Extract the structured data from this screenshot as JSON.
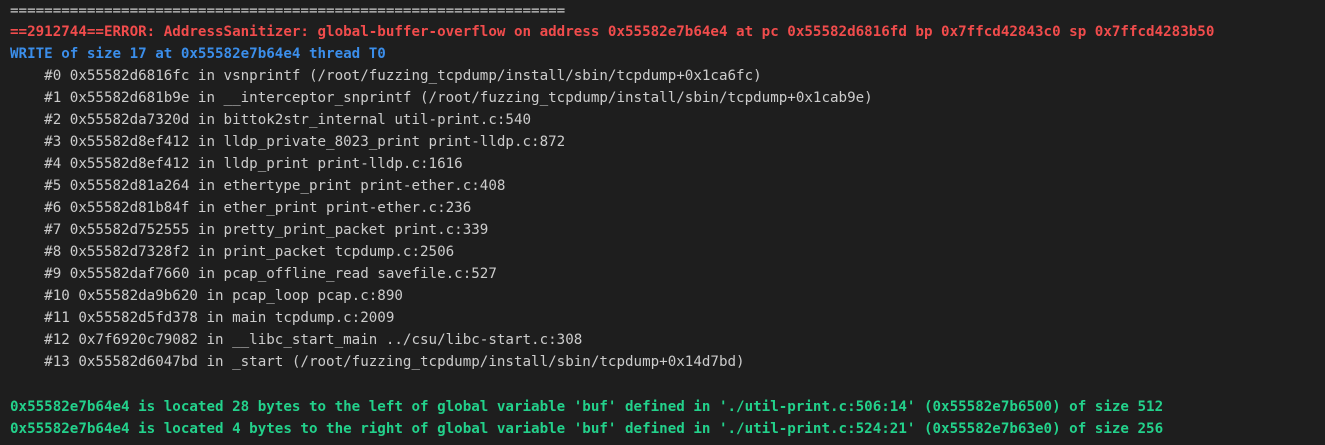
{
  "terminal": {
    "separator": "=================================================================",
    "error_header": "==2912744==ERROR: AddressSanitizer: global-buffer-overflow on address 0x55582e7b64e4 at pc 0x55582d6816fd bp 0x7ffcd42843c0 sp 0x7ffcd4283b50",
    "write_line": "WRITE of size 17 at 0x55582e7b64e4 thread T0",
    "frames": [
      "    #0 0x55582d6816fc in vsnprintf (/root/fuzzing_tcpdump/install/sbin/tcpdump+0x1ca6fc)",
      "    #1 0x55582d681b9e in __interceptor_snprintf (/root/fuzzing_tcpdump/install/sbin/tcpdump+0x1cab9e)",
      "    #2 0x55582da7320d in bittok2str_internal util-print.c:540",
      "    #3 0x55582d8ef412 in lldp_private_8023_print print-lldp.c:872",
      "    #4 0x55582d8ef412 in lldp_print print-lldp.c:1616",
      "    #5 0x55582d81a264 in ethertype_print print-ether.c:408",
      "    #6 0x55582d81b84f in ether_print print-ether.c:236",
      "    #7 0x55582d752555 in pretty_print_packet print.c:339",
      "    #8 0x55582d7328f2 in print_packet tcpdump.c:2506",
      "    #9 0x55582daf7660 in pcap_offline_read savefile.c:527",
      "    #10 0x55582da9b620 in pcap_loop pcap.c:890",
      "    #11 0x55582d5fd378 in main tcpdump.c:2009",
      "    #12 0x7f6920c79082 in __libc_start_main ../csu/libc-start.c:308",
      "    #13 0x55582d6047bd in _start (/root/fuzzing_tcpdump/install/sbin/tcpdump+0x14d7bd)"
    ],
    "location_left": "0x55582e7b64e4 is located 28 bytes to the left of global variable 'buf' defined in './util-print.c:506:14' (0x55582e7b6500) of size 512",
    "location_right": "0x55582e7b64e4 is located 4 bytes to the right of global variable 'buf' defined in './util-print.c:524:21' (0x55582e7b63e0) of size 256"
  },
  "colors": {
    "background": "#1e1e1e",
    "default_text": "#cccccc",
    "error_red": "#f14c4c",
    "info_blue": "#3b8eea",
    "location_green": "#23d18b"
  }
}
